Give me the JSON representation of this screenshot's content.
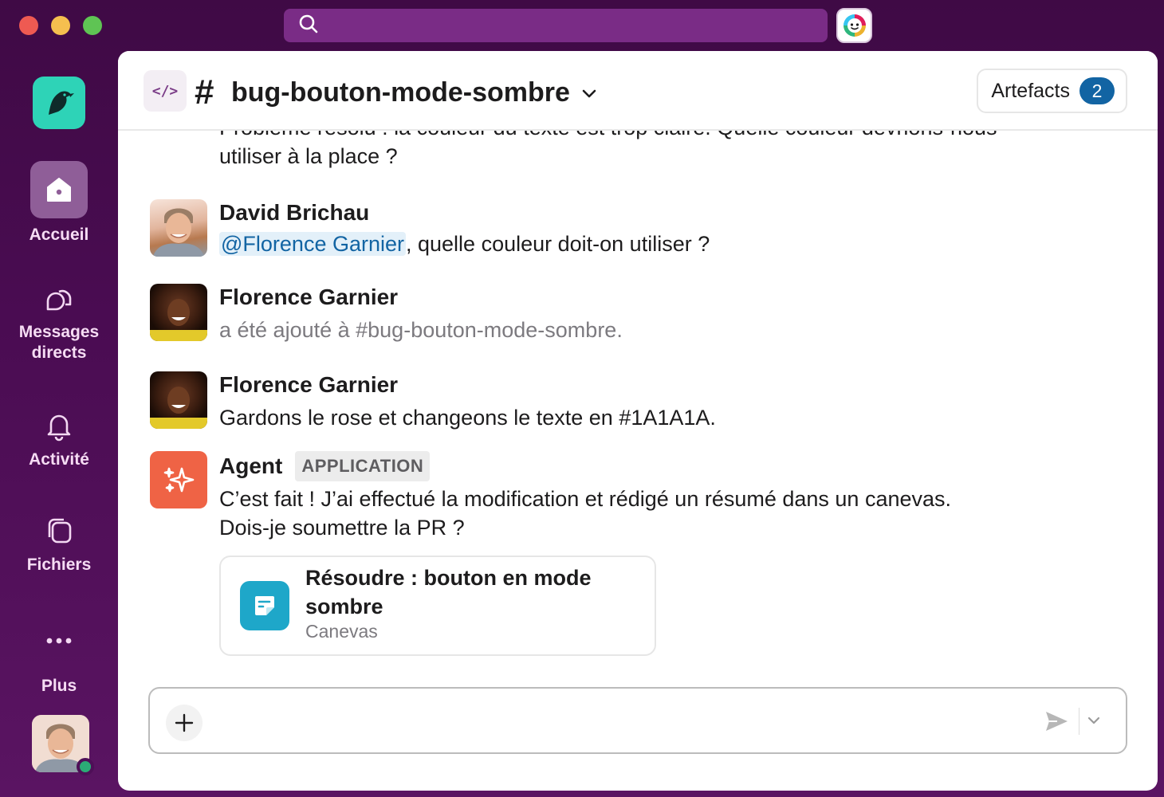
{
  "window": {
    "search_placeholder": ""
  },
  "rail": {
    "items": [
      {
        "label": "Accueil",
        "icon": "home-icon"
      },
      {
        "label": "Messages\ndirects",
        "icon": "dm-icon"
      },
      {
        "label": "Activité",
        "icon": "bell-icon"
      },
      {
        "label": "Fichiers",
        "icon": "files-icon"
      },
      {
        "label": "Plus",
        "icon": "more-icon"
      }
    ],
    "messages_line1": "Messages",
    "messages_line2": "directs"
  },
  "header": {
    "hash": "#",
    "channel_name": "bug-bouton-mode-sombre",
    "artefacts_label": "Artefacts",
    "artefacts_count": "2"
  },
  "messages": {
    "cut_line1": "Problème résolu : la couleur du texte est trop claire. Quelle couleur devrions-nous",
    "cut_line2": "utiliser à la place ?",
    "items": [
      {
        "author": "David Brichau",
        "mention": "@Florence Garnier",
        "text": ", quelle couleur doit-on utiliser ?"
      },
      {
        "author": "Florence Garnier",
        "text": "a été ajouté à #bug-bouton-mode-sombre."
      },
      {
        "author": "Florence Garnier",
        "text": "Gardons le rose et changeons le texte en #1A1A1A."
      },
      {
        "author": "Agent",
        "tag": "APPLICATION",
        "text_line1": "C’est fait ! J’ai effectué la modification et rédigé un résumé dans un canevas.",
        "text_line2": "Dois-je soumettre la PR ?"
      }
    ],
    "canvas": {
      "title": "Résoudre : bouton en mode sombre",
      "subtitle": "Canevas"
    }
  },
  "colors": {
    "sidebar": "#4a0c52",
    "accent_blue": "#1264a3",
    "agent_orange": "#ef6345",
    "workspace_teal": "#2ed3b7",
    "canvas_blue": "#1ea7c9"
  }
}
